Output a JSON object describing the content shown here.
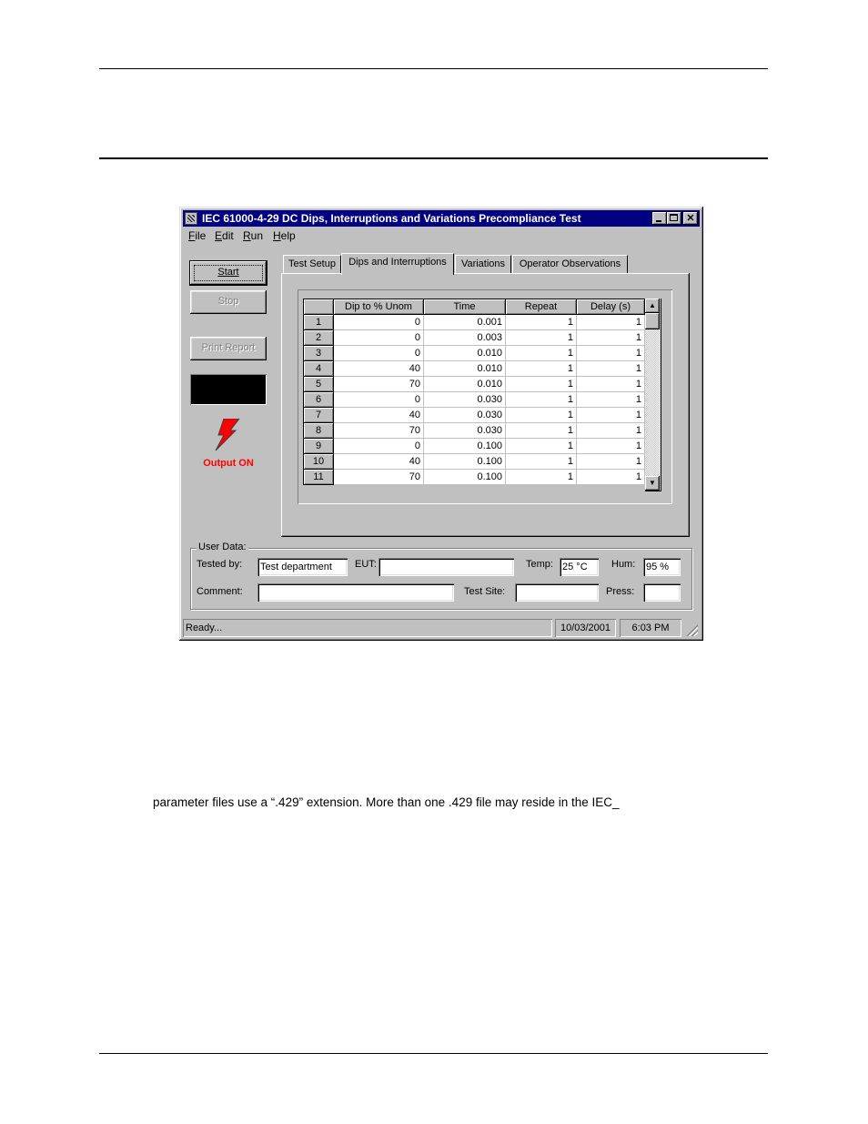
{
  "document": {
    "body_text": "parameter files use a “.429” extension.  More than one .429 file may reside in the IEC_"
  },
  "window": {
    "title": "IEC 61000-4-29 DC Dips, Interruptions and Variations Precompliance Test",
    "icon": "app-icon",
    "controls": {
      "minimize": "minimize-icon",
      "maximize": "maximize-icon",
      "close": "✕"
    }
  },
  "menu": [
    {
      "label": "File",
      "accel": "F"
    },
    {
      "label": "Edit",
      "accel": "E"
    },
    {
      "label": "Run",
      "accel": "R"
    },
    {
      "label": "Help",
      "accel": "H"
    }
  ],
  "side": {
    "start_label": "Start",
    "stop_label": "Stop",
    "print_label": "Print Report",
    "output_status": "Output ON",
    "output_color": "#ff0000",
    "output_icon": "lightning-bolt-icon"
  },
  "tabs": [
    {
      "label": "Test Setup",
      "active": false
    },
    {
      "label": "Dips and Interruptions",
      "active": true
    },
    {
      "label": "Variations",
      "active": false
    },
    {
      "label": "Operator Observations",
      "active": false
    }
  ],
  "grid": {
    "columns": [
      "",
      "Dip to % Unom",
      "Time",
      "Repeat",
      "Delay (s)"
    ],
    "rows": [
      [
        "1",
        "0",
        "0.001",
        "1",
        "1"
      ],
      [
        "2",
        "0",
        "0.003",
        "1",
        "1"
      ],
      [
        "3",
        "0",
        "0.010",
        "1",
        "1"
      ],
      [
        "4",
        "40",
        "0.010",
        "1",
        "1"
      ],
      [
        "5",
        "70",
        "0.010",
        "1",
        "1"
      ],
      [
        "6",
        "0",
        "0.030",
        "1",
        "1"
      ],
      [
        "7",
        "40",
        "0.030",
        "1",
        "1"
      ],
      [
        "8",
        "70",
        "0.030",
        "1",
        "1"
      ],
      [
        "9",
        "0",
        "0.100",
        "1",
        "1"
      ],
      [
        "10",
        "40",
        "0.100",
        "1",
        "1"
      ],
      [
        "11",
        "70",
        "0.100",
        "1",
        "1"
      ]
    ]
  },
  "user_data": {
    "group_label": "User Data:",
    "tested_by_label": "Tested by:",
    "tested_by_value": "Test department",
    "eut_label": "EUT:",
    "eut_value": "",
    "temp_label": "Temp:",
    "temp_value": "25 °C",
    "hum_label": "Hum:",
    "hum_value": "95 %",
    "comment_label": "Comment:",
    "comment_value": "",
    "test_site_label": "Test Site:",
    "test_site_value": "",
    "press_label": "Press:",
    "press_value": ""
  },
  "status": {
    "message": "Ready...",
    "date": "10/03/2001",
    "time": "6:03 PM"
  }
}
